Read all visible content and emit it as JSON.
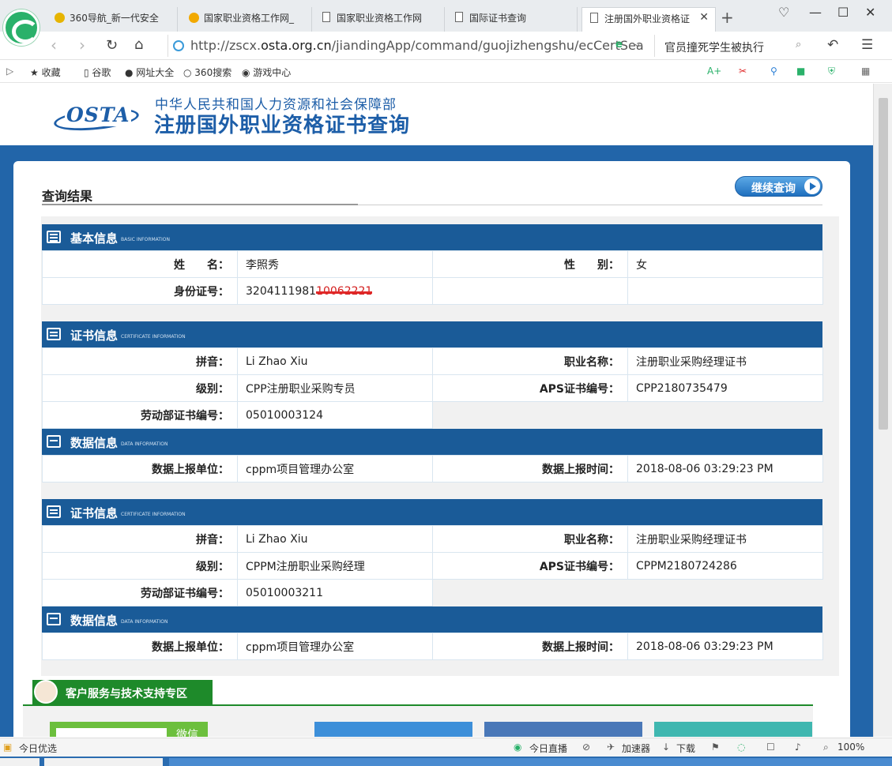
{
  "browser": {
    "tabs": [
      {
        "title": "360导航_新一代安全",
        "active": false
      },
      {
        "title": "国家职业资格工作网_",
        "active": false
      },
      {
        "title": "国家职业资格工作网",
        "active": false
      },
      {
        "title": "国际证书查询",
        "active": false
      },
      {
        "title": "注册国外职业资格证",
        "active": true
      }
    ],
    "url_prefix": "http://zscx.",
    "url_domain": "osta.org.cn",
    "url_path": "/jiandingApp/command/guojizhengshu/ecCertSea",
    "search_text": "官员撞死学生被执行",
    "favorites": [
      "收藏",
      "谷歌",
      "网址大全",
      "360搜索",
      "游戏中心"
    ]
  },
  "header": {
    "logo": "OSTA",
    "ministry": "中华人民共和国人力资源和社会保障部",
    "title": "注册国外职业资格证书查询"
  },
  "result": {
    "title": "查询结果",
    "continue_label": "继续查询"
  },
  "basic": {
    "title": "基本信息",
    "subtitle": "BASIC INFORMATION",
    "name_label": "姓　　名：",
    "name": "李照秀",
    "gender_label": "性　　别：",
    "gender": "女",
    "id_label": "身份证号：",
    "id_visible": "3204111981",
    "id_redacted": "10062221"
  },
  "certificates": [
    {
      "title": "证书信息",
      "subtitle": "CERTIFICATE INFORMATION",
      "pinyin_label": "拼音：",
      "pinyin": "Li Zhao Xiu",
      "job_label": "职业名称：",
      "job": "注册职业采购经理证书",
      "level_label": "级别：",
      "level": "CPP注册职业采购专员",
      "aps_label": "APS证书编号：",
      "aps": "CPP2180735479",
      "labor_label": "劳动部证书编号：",
      "labor": "05010003124",
      "data_title": "数据信息",
      "data_subtitle": "DATA INFORMATION",
      "unit_label": "数据上报单位：",
      "unit": "cppm项目管理办公室",
      "time_label": "数据上报时间：",
      "time": "2018-08-06 03:29:23 PM"
    },
    {
      "title": "证书信息",
      "subtitle": "CERTIFICATE INFORMATION",
      "pinyin_label": "拼音：",
      "pinyin": "Li Zhao Xiu",
      "job_label": "职业名称：",
      "job": "注册职业采购经理证书",
      "level_label": "级别：",
      "level": "CPPM注册职业采购经理",
      "aps_label": "APS证书编号：",
      "aps": "CPPM2180724286",
      "labor_label": "劳动部证书编号：",
      "labor": "05010003211",
      "data_title": "数据信息",
      "data_subtitle": "DATA INFORMATION",
      "unit_label": "数据上报单位：",
      "unit": "cppm项目管理办公室",
      "time_label": "数据上报时间：",
      "time": "2018-08-06 03:29:23 PM"
    }
  ],
  "service": {
    "title": "客户服务与技术支持专区",
    "card_label": "微信扫一扫"
  },
  "statusbar": {
    "left": "今日优选",
    "live": "今日直播",
    "accelerator": "加速器",
    "download": "下载",
    "zoom": "100%"
  },
  "colors": {
    "section_header": "#1a5b98",
    "page_bg": "#2265a9",
    "service_green": "#1e8a2a"
  }
}
